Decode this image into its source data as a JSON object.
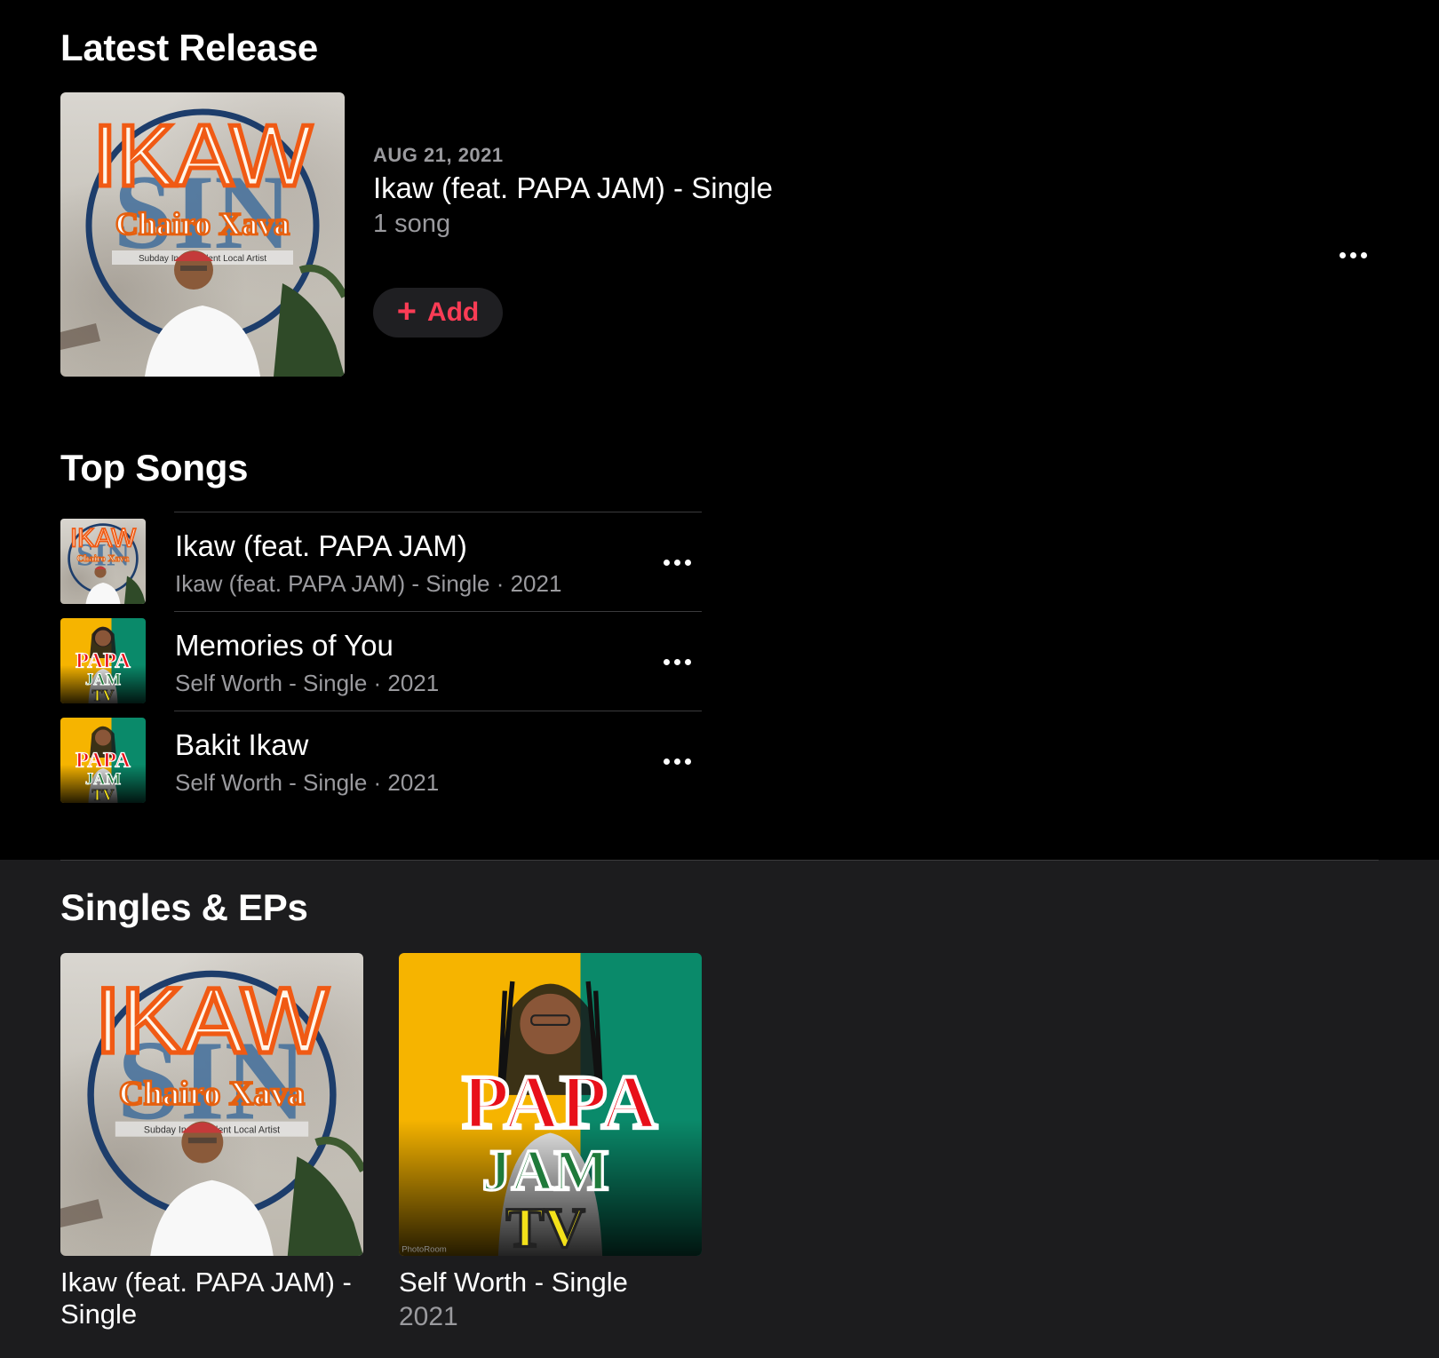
{
  "latest_release": {
    "heading": "Latest Release",
    "date": "AUG 21, 2021",
    "title": "Ikaw (feat. PAPA JAM) - Single",
    "song_count": "1 song",
    "add_label": "Add",
    "art": {
      "line1": "IKAW",
      "line2": "Chairo Xava",
      "line3": "Subday Independent Local Artist"
    }
  },
  "top_songs": {
    "heading": "Top Songs",
    "items": [
      {
        "title": "Ikaw (feat. PAPA JAM)",
        "subtitle": "Ikaw (feat. PAPA JAM) - Single · 2021"
      },
      {
        "title": "Memories of You",
        "subtitle": "Self Worth - Single · 2021"
      },
      {
        "title": "Bakit Ikaw",
        "subtitle": "Self Worth - Single · 2021"
      }
    ]
  },
  "papa_art": {
    "line1": "PAPA",
    "line2": "JAM",
    "line3": "TV",
    "watermark": "PhotoRoom"
  },
  "singles": {
    "heading": "Singles & EPs",
    "items": [
      {
        "title_line1": "Ikaw (feat. PAPA JAM) -",
        "title_line2": "Single",
        "subtitle": ""
      },
      {
        "title_line1": "Self Worth - Single",
        "title_line2": "",
        "subtitle": "2021"
      }
    ]
  },
  "colors": {
    "accent": "#fb3c55",
    "background": "#000000",
    "secondary_bg": "#1c1c1e",
    "secondary_text": "#9a9a9e"
  }
}
